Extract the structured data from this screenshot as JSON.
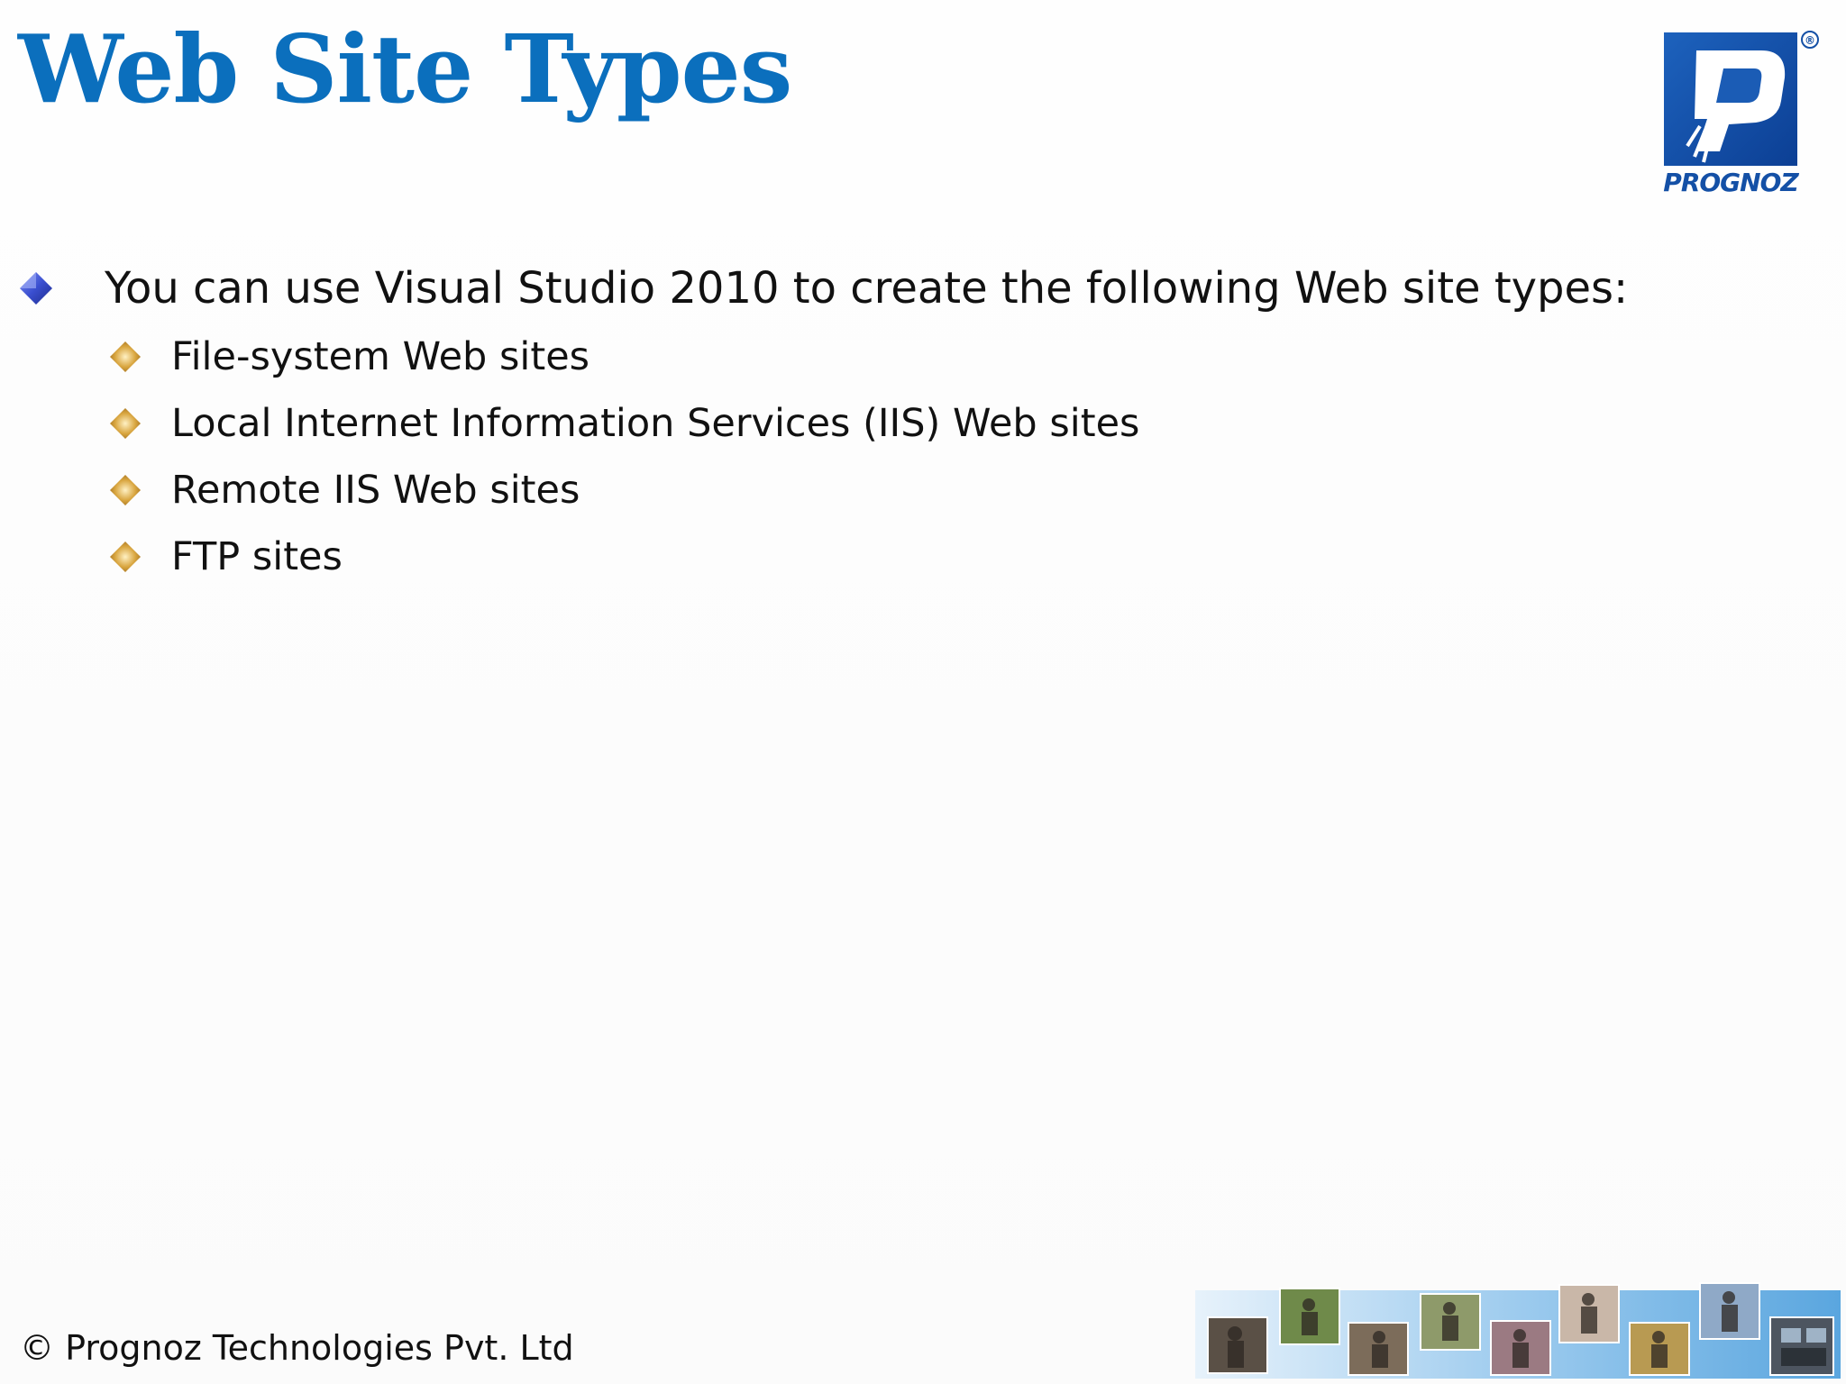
{
  "slide": {
    "title": "Web Site Types",
    "logo": {
      "text": "PROGNOZ",
      "registered_mark": "®",
      "color": "#1450a6"
    },
    "intro": "You can use Visual Studio 2010 to create the following Web site types:",
    "items": [
      {
        "label": "File-system Web sites"
      },
      {
        "label": "Local Internet Information Services (IIS) Web sites"
      },
      {
        "label": "Remote IIS Web sites"
      },
      {
        "label": "FTP sites"
      }
    ],
    "footer": "© Prognoz Technologies Pvt. Ltd"
  },
  "colors": {
    "title": "#0b6fbd",
    "level1_bullet": "#3a4fd0",
    "level2_bullet": "#c9942f",
    "body_text": "#111111"
  },
  "icons": {
    "level1_bullet": "diamond-bullet-icon",
    "level2_bullet": "diamond-bullet-icon",
    "logo": "prognoz-logo-icon",
    "photo_strip": "photo-strip-image"
  }
}
